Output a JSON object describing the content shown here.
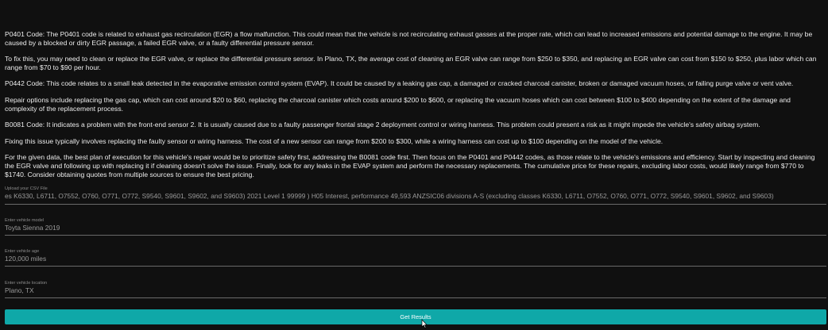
{
  "results": {
    "paragraphs": [
      "P0401 Code: The P0401 code is related to exhaust gas recirculation (EGR) a flow malfunction. This could mean that the vehicle is not recirculating exhaust gasses at the proper rate, which can lead to increased emissions and potential damage to the engine. It may be caused by a blocked or dirty EGR passage, a failed EGR valve, or a faulty differential pressure sensor.",
      "To fix this, you may need to clean or replace the EGR valve, or replace the differential pressure sensor. In Plano, TX, the average cost of cleaning an EGR valve can range from $250 to $350, and replacing an EGR valve can cost from $150 to $250, plus labor which can range from $70 to $90 per hour.",
      "P0442 Code: This code relates to a small leak detected in the evaporative emission control system (EVAP). It could be caused by a leaking gas cap, a damaged or cracked charcoal canister, broken or damaged vacuum hoses, or failing purge valve or vent valve.",
      "Repair options include replacing the gas cap, which can cost around $20 to $60, replacing the charcoal canister which costs around $200 to $600, or replacing the vacuum hoses which can cost between $100 to $400 depending on the extent of the damage and complexity of the replacement process.",
      "B0081 Code: It indicates a problem with the front-end sensor 2. It is usually caused due to a faulty passenger frontal stage 2 deployment control or wiring harness. This problem could present a risk as it might impede the vehicle's safety airbag system.",
      "Fixing this issue typically involves replacing the faulty sensor or wiring harness. The cost of a new sensor can range from $200 to $300, while a wiring harness can cost up to $100 depending on the model of the vehicle.",
      "For the given data, the best plan of execution for this vehicle's repair would be to prioritize safety first, addressing the B0081 code first. Then focus on the P0401 and P0442 codes, as those relate to the vehicle's emissions and efficiency. Start by inspecting and cleaning the EGR valve and following up with replacing it if cleaning doesn't solve the issue. Finally, look for any leaks in the EVAP system and perform the necessary replacements. The cumulative price for these repairs, excluding labor costs, would likely range from $770 to $1740. Consider obtaining quotes from multiple sources to ensure the best pricing."
    ]
  },
  "form": {
    "csv": {
      "label": "Upload your CSV File",
      "value": "es K6330, L6711, O7552, O760, O771, O772, S9540, S9601, S9602, and S9603) 2021    Level 1    99999    )    H05    Interest,       performance    49,593    ANZSIC06 divisions A-S (excluding classes K6330, L6711, O7552, O760, O771, O772, S9540, S9601, S9602, and S9603)"
    },
    "model": {
      "label": "Enter vehicle model",
      "value": "Toyta Sienna 2019"
    },
    "age": {
      "label": "Enter vehicle age",
      "value": "120,000 miles"
    },
    "location": {
      "label": "Enter vehicle location",
      "value": "Plano, TX"
    },
    "submit_label": "Get Results"
  }
}
